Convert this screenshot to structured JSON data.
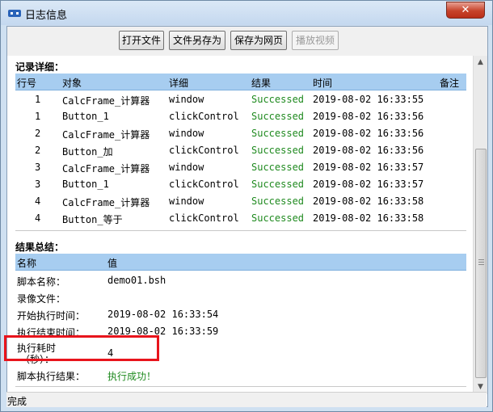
{
  "window": {
    "title": "日志信息",
    "close_label": "✕"
  },
  "toolbar": {
    "buttons": [
      {
        "label": "打开文件",
        "enabled": true
      },
      {
        "label": "文件另存为",
        "enabled": true
      },
      {
        "label": "保存为网页",
        "enabled": true
      },
      {
        "label": "播放视频",
        "enabled": false
      }
    ]
  },
  "details": {
    "title": "记录详细：",
    "columns": [
      "行号",
      "对象",
      "详细",
      "结果",
      "时间",
      "备注"
    ],
    "rows": [
      {
        "no": "1",
        "object": "CalcFrame_计算器",
        "detail": "window",
        "result": "Successed",
        "time": "2019-08-02 16:33:55"
      },
      {
        "no": "1",
        "object": "Button_1",
        "detail": "clickControl",
        "result": "Successed",
        "time": "2019-08-02 16:33:56"
      },
      {
        "no": "2",
        "object": "CalcFrame_计算器",
        "detail": "window",
        "result": "Successed",
        "time": "2019-08-02 16:33:56"
      },
      {
        "no": "2",
        "object": "Button_加",
        "detail": "clickControl",
        "result": "Successed",
        "time": "2019-08-02 16:33:56"
      },
      {
        "no": "3",
        "object": "CalcFrame_计算器",
        "detail": "window",
        "result": "Successed",
        "time": "2019-08-02 16:33:57"
      },
      {
        "no": "3",
        "object": "Button_1",
        "detail": "clickControl",
        "result": "Successed",
        "time": "2019-08-02 16:33:57"
      },
      {
        "no": "4",
        "object": "CalcFrame_计算器",
        "detail": "window",
        "result": "Successed",
        "time": "2019-08-02 16:33:58"
      },
      {
        "no": "4",
        "object": "Button_等于",
        "detail": "clickControl",
        "result": "Successed",
        "time": "2019-08-02 16:33:58"
      }
    ]
  },
  "summary": {
    "title": "结果总结：",
    "columns": [
      "名称",
      "值"
    ],
    "rows": [
      {
        "name": "脚本名称：",
        "value": "demo01.bsh"
      },
      {
        "name": "录像文件：",
        "value": ""
      },
      {
        "name": "开始执行时间：",
        "value": "2019-08-02 16:33:54"
      },
      {
        "name": "执行结束时间：",
        "value": "2019-08-02 16:33:59"
      },
      {
        "name": "执行耗时",
        "name2": "（秒）：",
        "value": "4"
      },
      {
        "name": "脚本执行结果：",
        "value": "执行成功！"
      }
    ]
  },
  "status": {
    "text": "完成"
  },
  "colors": {
    "header_bg": "#a7cdf0",
    "success": "#1f8a1f",
    "highlight": "#e8141c"
  }
}
